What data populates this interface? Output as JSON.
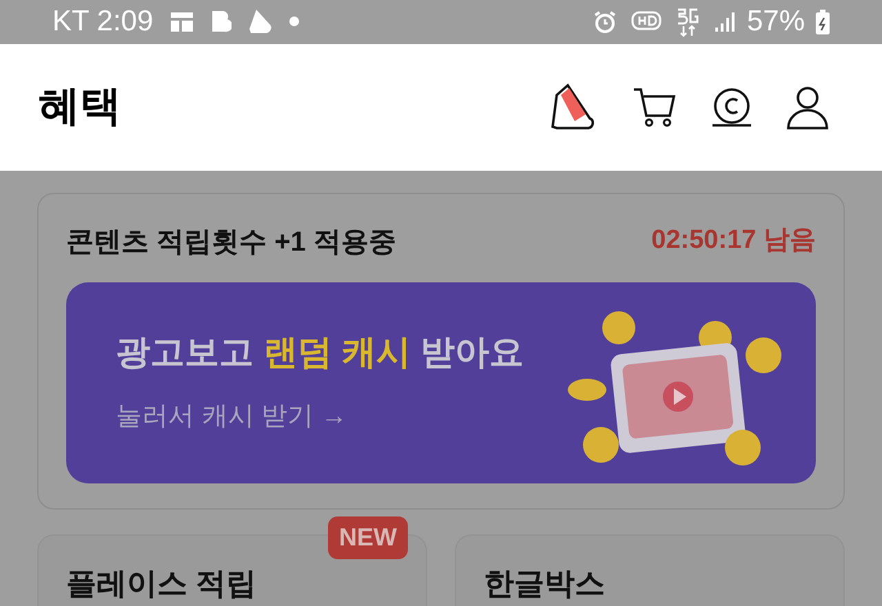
{
  "status_bar": {
    "carrier_time": "KT 2:09",
    "battery": "57%"
  },
  "header": {
    "title": "혜택"
  },
  "promo": {
    "title": "콘텐츠 적립횟수 +1 적용중",
    "timer": "02:50:17 남음",
    "banner": {
      "headline": [
        {
          "text": "광고보고 ",
          "highlight": false
        },
        {
          "text": "랜덤 캐시",
          "highlight": true
        },
        {
          "text": " 받아요",
          "highlight": false
        }
      ],
      "cta": "눌러서 캐시 받기 →"
    }
  },
  "cards": [
    {
      "title": "플레이스 적립",
      "badge": "NEW"
    },
    {
      "title": "한글박스"
    }
  ]
}
